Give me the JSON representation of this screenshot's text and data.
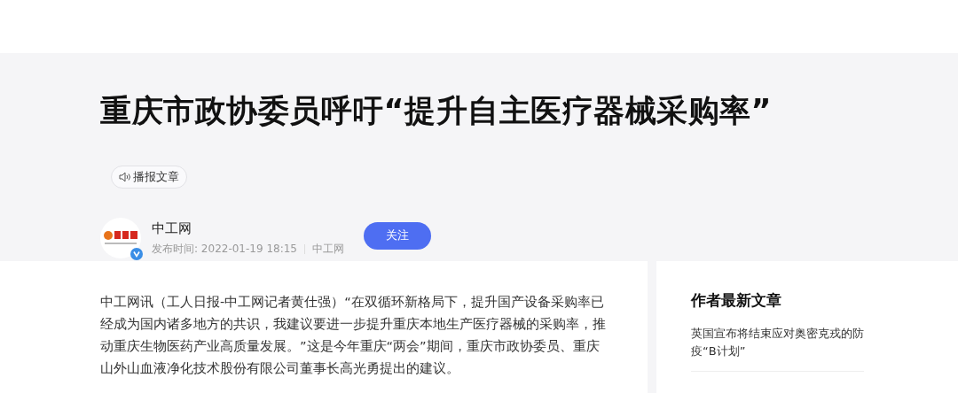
{
  "article": {
    "title": "重庆市政协委员呼吁“提升自主医疗器械采购率”",
    "listen_button": "播报文章",
    "author": {
      "name": "中工网",
      "meta_label": "发布时间: 2022-01-19 18:15",
      "source": "中工网",
      "verified": true,
      "follow_button": "关注"
    },
    "body": [
      "中工网讯（工人日报-中工网记者黄仕强）“在双循环新格局下，提升国产设备采购率已经成为国内诸多地方的共识，我建议要进一步提升重庆本地生产医疗器械的采购率，推动重庆生物医药产业高质量发展。”这是今年重庆“两会”期间，重庆市政协委员、重庆山外山血液净化技术股份有限公司董事长高光勇提出的建议。"
    ]
  },
  "sidebar": {
    "title": "作者最新文章",
    "articles": [
      "英国宣布将结束应对奥密克戎的防疫“B计划”"
    ]
  }
}
